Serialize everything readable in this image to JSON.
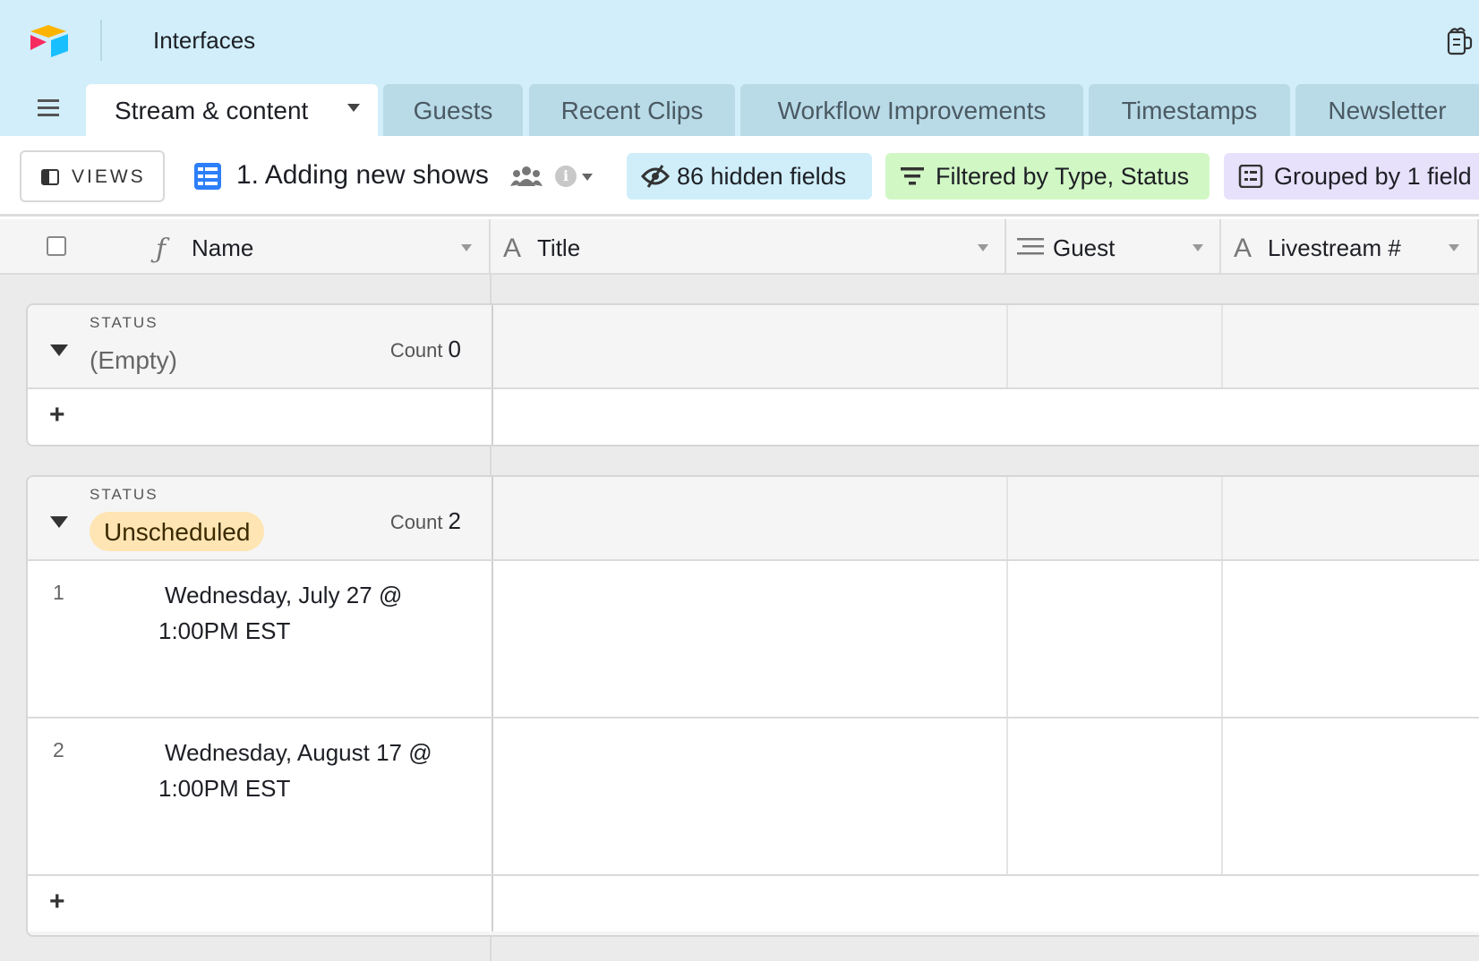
{
  "app": {
    "title": "Interfaces"
  },
  "tabs": [
    {
      "label": "Stream & content",
      "active": true
    },
    {
      "label": "Guests"
    },
    {
      "label": "Recent Clips"
    },
    {
      "label": "Workflow Improvements"
    },
    {
      "label": "Timestamps"
    },
    {
      "label": "Newsletter"
    }
  ],
  "viewbar": {
    "views_label": "VIEWS",
    "view_name": "1. Adding new shows",
    "hidden_fields": "86 hidden fields",
    "filter": "Filtered by Type, Status",
    "group": "Grouped by 1 field"
  },
  "columns": [
    {
      "name": "Name",
      "icon": "formula-icon"
    },
    {
      "name": "Title",
      "icon": "text-icon"
    },
    {
      "name": "Guest",
      "icon": "long-text-icon"
    },
    {
      "name": "Livestream #",
      "icon": "text-icon"
    }
  ],
  "groups": [
    {
      "label": "STATUS",
      "value": "(Empty)",
      "count_label": "Count",
      "count": "0",
      "rows": []
    },
    {
      "label": "STATUS",
      "value": "Unscheduled",
      "count_label": "Count",
      "count": "2",
      "rows": [
        {
          "num": "1",
          "name": "Wednesday, July 27 @ 1:00PM EST"
        },
        {
          "num": "2",
          "name": "Wednesday, August 17 @ 1:00PM EST"
        }
      ]
    }
  ],
  "add_symbol": "+",
  "colors": {
    "topbar": "#d1eefa",
    "hidden_pill": "#cfeefa",
    "filter_pill": "#d1f7c4",
    "group_pill": "#e8e1fb",
    "unscheduled_badge": "#ffe5b3",
    "grid_icon": "#2d7ff9"
  }
}
